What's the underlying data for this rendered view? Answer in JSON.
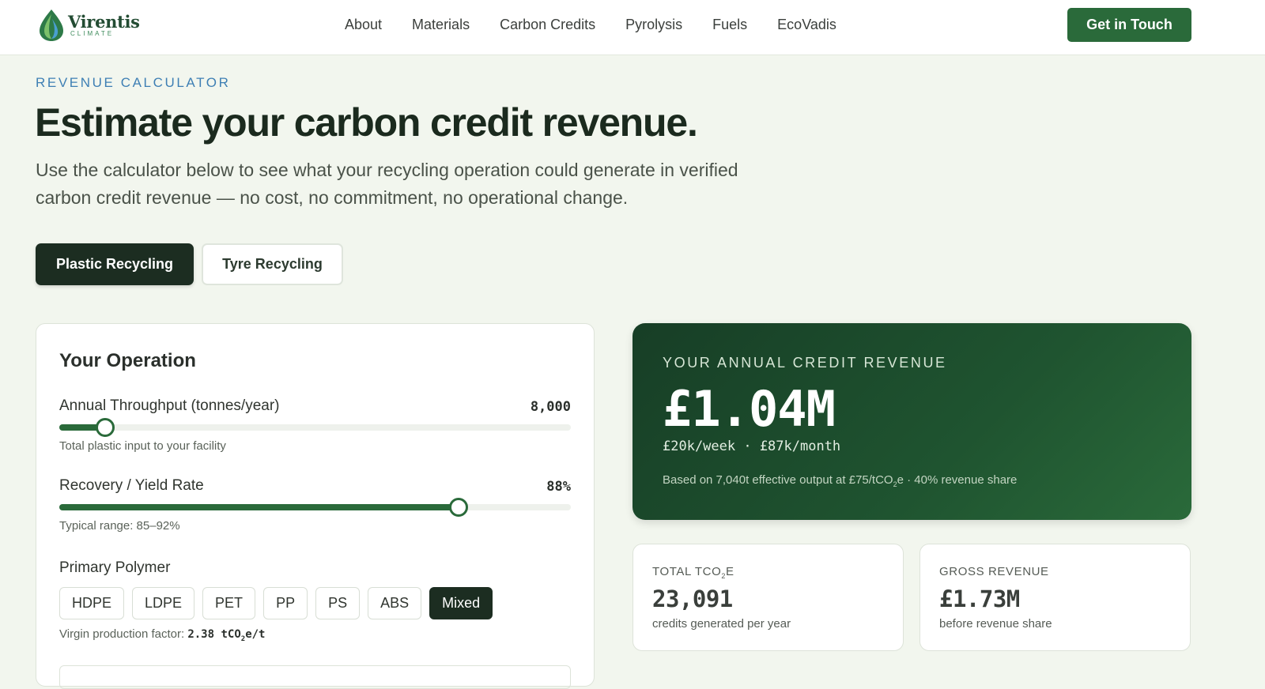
{
  "brand": {
    "name": "Virentis",
    "tagline": "CLIMATE"
  },
  "nav": {
    "links": [
      "About",
      "Materials",
      "Carbon Credits",
      "Pyrolysis",
      "Fuels",
      "EcoVadis"
    ],
    "cta": "Get in Touch"
  },
  "hero": {
    "eyebrow": "REVENUE CALCULATOR",
    "title": "Estimate your carbon credit revenue.",
    "lede": "Use the calculator below to see what your recycling operation could generate in verified carbon credit revenue — no cost, no commitment, no operational change."
  },
  "tabs": [
    {
      "label": "Plastic Recycling",
      "active": true
    },
    {
      "label": "Tyre Recycling",
      "active": false
    }
  ],
  "operation": {
    "title": "Your Operation",
    "throughput": {
      "label": "Annual Throughput (tonnes/year)",
      "value": "8,000",
      "hint": "Total plastic input to your facility",
      "fraction": 0.09
    },
    "yield": {
      "label": "Recovery / Yield Rate",
      "value": "88%",
      "hint": "Typical range: 85–92%",
      "fraction": 0.78
    },
    "polymer": {
      "label": "Primary Polymer",
      "options": [
        "HDPE",
        "LDPE",
        "PET",
        "PP",
        "PS",
        "ABS",
        "Mixed"
      ],
      "selected": "Mixed",
      "factor_label": "Virgin production factor:",
      "factor_value": "2.38 tCO",
      "factor_sub": "2",
      "factor_unit": "e/t"
    }
  },
  "revenue": {
    "eyebrow": "YOUR ANNUAL CREDIT REVENUE",
    "amount": "£1.04M",
    "rate": "£20k/week · £87k/month",
    "basis_prefix": "Based on 7,040t effective output at £75/tCO",
    "basis_sub": "2",
    "basis_suffix": "e · 40% revenue share"
  },
  "stats": [
    {
      "label_prefix": "TOTAL TCO",
      "label_sub": "2",
      "label_suffix": "E",
      "value": "23,091",
      "note": "credits generated per year"
    },
    {
      "label_prefix": "GROSS REVENUE",
      "label_sub": "",
      "label_suffix": "",
      "value": "£1.73M",
      "note": "before revenue share"
    }
  ],
  "colors": {
    "accent": "#2a6a3a",
    "dark": "#1c2d21",
    "eyebrow": "#3e7fb4",
    "background": "#f2f6ee"
  }
}
